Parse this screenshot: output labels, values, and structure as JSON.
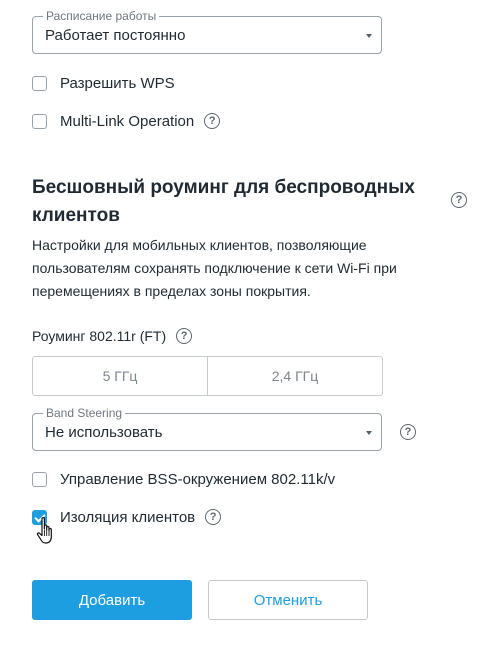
{
  "schedule": {
    "legend": "Расписание работы",
    "value": "Работает постоянно"
  },
  "options": {
    "wps_label": "Разрешить WPS",
    "mlo_label": "Multi-Link Operation"
  },
  "roaming": {
    "title": "Бесшовный роуминг для беспроводных клиентов",
    "description": "Настройки для мобильных клиентов, позволяющие пользователям сохранять подключение к сети Wi-Fi при перемещениях в пределах зоны покрытия.",
    "ft_label": "Роуминг 802.11r (FT)",
    "bands": [
      "5 ГГц",
      "2,4 ГГц"
    ],
    "band_steering": {
      "legend": "Band Steering",
      "value": "Не использовать"
    },
    "bss_label": "Управление BSS-окружением 802.11k/v",
    "isolation_label": "Изоляция клиентов",
    "isolation_checked": true
  },
  "help_glyph": "?",
  "actions": {
    "add_label": "Добавить",
    "cancel_label": "Отменить"
  },
  "colors": {
    "accent": "#1d9ee0",
    "text": "#1f2a33",
    "border": "#c5cbd0"
  },
  "icons": [
    "help-icon",
    "chevron-down-icon",
    "check-icon",
    "hand-pointer-cursor-icon"
  ]
}
